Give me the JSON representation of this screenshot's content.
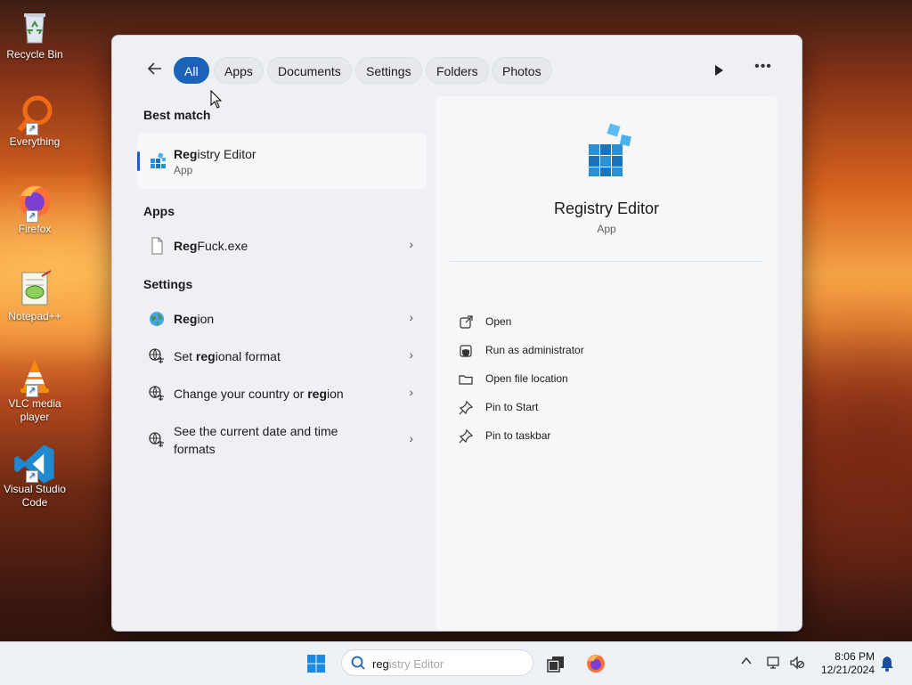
{
  "desktop": {
    "icons": [
      {
        "label_line1": "Recycle Bin",
        "label_line2": ""
      },
      {
        "label_line1": "Everything",
        "label_line2": ""
      },
      {
        "label_line1": "Firefox",
        "label_line2": ""
      },
      {
        "label_line1": "Notepad++",
        "label_line2": ""
      },
      {
        "label_line1": "VLC media",
        "label_line2": "player"
      },
      {
        "label_line1": "Visual Studio",
        "label_line2": "Code"
      }
    ]
  },
  "search_panel": {
    "tabs": [
      "All",
      "Apps",
      "Documents",
      "Settings",
      "Folders",
      "Photos"
    ],
    "active_tab": "All",
    "sections": {
      "best_match": "Best match",
      "apps": "Apps",
      "settings": "Settings"
    },
    "best_match": {
      "name_bold": "Reg",
      "name_rest": "istry Editor",
      "type": "App"
    },
    "apps": [
      {
        "name_bold": "Reg",
        "name_rest": "Fuck.exe",
        "icon": "file-icon"
      }
    ],
    "settings": [
      {
        "pre": "",
        "bold": "Reg",
        "post": "ion",
        "line2": "",
        "icon": "globe-icon"
      },
      {
        "pre": "Set ",
        "bold": "reg",
        "post": "ional format",
        "line2": "",
        "icon": "region-format-icon"
      },
      {
        "pre": "Change your country or ",
        "bold": "reg",
        "post": "ion",
        "line2": "",
        "icon": "region-format-icon"
      },
      {
        "pre": "See the current date and time",
        "bold": "",
        "post": "",
        "line2": "formats",
        "icon": "region-format-icon"
      }
    ],
    "detail": {
      "title": "Registry Editor",
      "subtitle": "App",
      "actions": [
        {
          "label": "Open",
          "icon": "open-external-icon"
        },
        {
          "label": "Run as administrator",
          "icon": "shield-icon"
        },
        {
          "label": "Open file location",
          "icon": "folder-icon"
        },
        {
          "label": "Pin to Start",
          "icon": "pin-icon"
        },
        {
          "label": "Pin to taskbar",
          "icon": "pin-icon"
        }
      ]
    }
  },
  "taskbar": {
    "search_typed": "reg",
    "search_completion": "istry Editor",
    "time": "8:06 PM",
    "date": "12/21/2024"
  },
  "colors": {
    "accent": "#1a63b8",
    "panel_bg": "#eef0f4",
    "taskbar_bg": "#eef1f6"
  }
}
